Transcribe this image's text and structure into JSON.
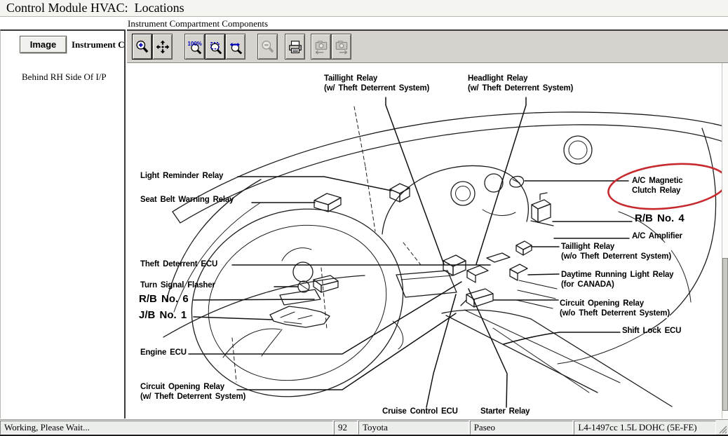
{
  "header": {
    "title": "Control Module HVAC:  Locations",
    "subtitle": "Instrument Compartment Components"
  },
  "sidebar": {
    "image_tab_label": "Image",
    "tab_caption": "Instrument C",
    "location_note": "Behind RH Side Of I/P"
  },
  "toolbar": {
    "zoom_100_text": "100%",
    "buttons": [
      {
        "name": "zoom-in",
        "icon": "magnifier-plus-icon",
        "enabled": true,
        "active": true
      },
      {
        "name": "pan",
        "icon": "pan-arrows-icon",
        "enabled": true,
        "active": false
      },
      {
        "name": "zoom-100",
        "icon": "magnifier-100-icon",
        "enabled": true,
        "active": false
      },
      {
        "name": "zoom-fit",
        "icon": "magnifier-fit-icon",
        "enabled": true,
        "active": true
      },
      {
        "name": "zoom-width",
        "icon": "magnifier-width-icon",
        "enabled": true,
        "active": false
      },
      {
        "name": "zoom-out",
        "icon": "magnifier-minus-icon",
        "enabled": false,
        "active": false
      },
      {
        "name": "print",
        "icon": "printer-icon",
        "enabled": true,
        "active": false
      },
      {
        "name": "prev-image",
        "icon": "camera-left-icon",
        "enabled": false,
        "active": false
      },
      {
        "name": "next-image",
        "icon": "camera-right-icon",
        "enabled": false,
        "active": false
      }
    ]
  },
  "diagram": {
    "highlight_color": "#c62a2e",
    "labels": [
      {
        "id": "taillight-relay-w-tds",
        "text": "Taillight Relay\n(w/ Theft Deterrent System)"
      },
      {
        "id": "headlight-relay-w-tds",
        "text": "Headlight Relay\n(w/ Theft Deterrent System)"
      },
      {
        "id": "light-reminder-relay",
        "text": "Light Reminder Relay"
      },
      {
        "id": "seat-belt-warning-relay",
        "text": "Seat Belt Warning Relay"
      },
      {
        "id": "theft-deterrent-ecu",
        "text": "Theft Deterrent ECU"
      },
      {
        "id": "turn-signal-flasher",
        "text": "Turn Signal Flasher"
      },
      {
        "id": "rb-no-6",
        "text": "R/B No. 6"
      },
      {
        "id": "jb-no-1",
        "text": "J/B No. 1"
      },
      {
        "id": "engine-ecu",
        "text": "Engine ECU"
      },
      {
        "id": "circuit-opening-relay-w-tds",
        "text": "Circuit Opening Relay\n(w/ Theft Deterrent System)"
      },
      {
        "id": "cruise-control-ecu",
        "text": "Cruise Control ECU"
      },
      {
        "id": "starter-relay",
        "text": "Starter Relay"
      },
      {
        "id": "ac-magnetic-clutch-relay",
        "text": "A/C Magnetic\nClutch Relay"
      },
      {
        "id": "rb-no-4",
        "text": "R/B No. 4"
      },
      {
        "id": "ac-amplifier",
        "text": "A/C Amplifier"
      },
      {
        "id": "taillight-relay-wo-tds",
        "text": "Taillight Relay\n(w/o Theft Deterrent System)"
      },
      {
        "id": "daytime-running-light-relay",
        "text": "Daytime Running Light Relay\n(for CANADA)"
      },
      {
        "id": "circuit-opening-relay-wo-tds",
        "text": "Circuit Opening Relay\n(w/o Theft Deterrent System)"
      },
      {
        "id": "shift-lock-ecu",
        "text": "Shift Lock ECU"
      }
    ]
  },
  "statusbar": {
    "message": "Working, Please Wait...",
    "code": "92",
    "make": "Toyota",
    "model": "Paseo",
    "engine": "L4-1497cc 1.5L DOHC (5E-FE)"
  }
}
